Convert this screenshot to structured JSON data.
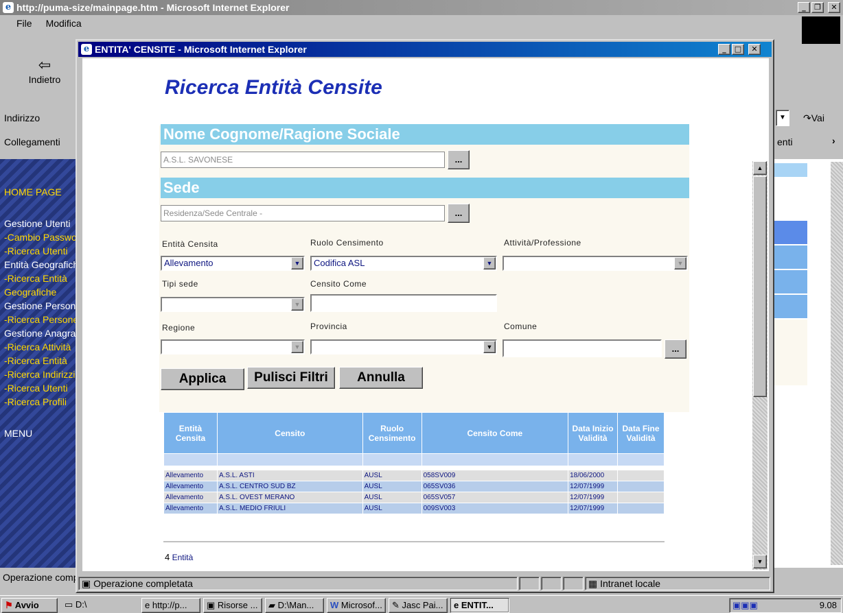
{
  "outer_window": {
    "title": "http://puma-size/mainpage.htm - Microsoft Internet Explorer",
    "menu": [
      "File",
      "Modifica"
    ],
    "back_label": "Indietro",
    "address_label": "Indirizzo",
    "links_label": "Collegamenti",
    "links_right": "enti",
    "go_label": "Vai",
    "status": "Operazione completata",
    "sidebar": {
      "home": "HOME PAGE",
      "items": [
        "Gestione Utenti",
        "-Cambio Password",
        "-Ricerca Utenti",
        "Entità Geografiche",
        "-Ricerca Entità",
        "Geografiche",
        "Gestione Persone",
        "-Ricerca Persone",
        "Gestione Anagrafe",
        "-Ricerca Attività",
        "-Ricerca Entità",
        "-Ricerca Indirizzi",
        "-Ricerca Utenti",
        "-Ricerca Profili"
      ],
      "menu": "MENU"
    }
  },
  "inner_window": {
    "title": "ENTITA' CENSITE - Microsoft Internet Explorer",
    "heading": "Ricerca Entità Censite",
    "section_name": "Nome Cognome/Ragione Sociale",
    "name_value": "A.S.L. SAVONESE",
    "section_site": "Sede",
    "site_value": "Residenza/Sede Centrale -",
    "browse": "...",
    "labels": {
      "entita": "Entità Censita",
      "ruolo": "Ruolo Censimento",
      "attivita": "Attività/Professione",
      "tipi_sede": "Tipi sede",
      "censito_come": "Censito Come",
      "regione": "Regione",
      "provincia": "Provincia",
      "comune": "Comune"
    },
    "values": {
      "entita": "Allevamento",
      "ruolo": "Codifica ASL",
      "attivita": "",
      "tipi_sede": "",
      "censito_come": "",
      "regione": "",
      "provincia": "",
      "comune": ""
    },
    "buttons": {
      "apply": "Applica",
      "clear": "Pulisci Filtri",
      "cancel": "Annulla"
    },
    "table": {
      "headers": [
        "Entità Censita",
        "Censito",
        "Ruolo Censimento",
        "Censito Come",
        "Data Inizio Validità",
        "Data Fine Validità"
      ],
      "rows": [
        [
          "Allevamento",
          "A.S.L. ASTI",
          "AUSL",
          "058SV009",
          "18/06/2000",
          ""
        ],
        [
          "Allevamento",
          "A.S.L. CENTRO SUD BZ",
          "AUSL",
          "065SV036",
          "12/07/1999",
          ""
        ],
        [
          "Allevamento",
          "A.S.L. OVEST MERANO",
          "AUSL",
          "065SV057",
          "12/07/1999",
          ""
        ],
        [
          "Allevamento",
          "A.S.L. MEDIO FRIULI",
          "AUSL",
          "009SV003",
          "12/07/1999",
          ""
        ]
      ]
    },
    "count_number": "4",
    "count_label": "Entità",
    "status": "Operazione completata",
    "zone": "Intranet locale"
  },
  "taskbar": {
    "start": "Avvio",
    "tasks": [
      "D:\\",
      "http://p...",
      "Risorse ...",
      "D:\\Man...",
      "Microsof...",
      "Jasc Pai...",
      "ENTIT..."
    ],
    "clock": "9.08"
  }
}
